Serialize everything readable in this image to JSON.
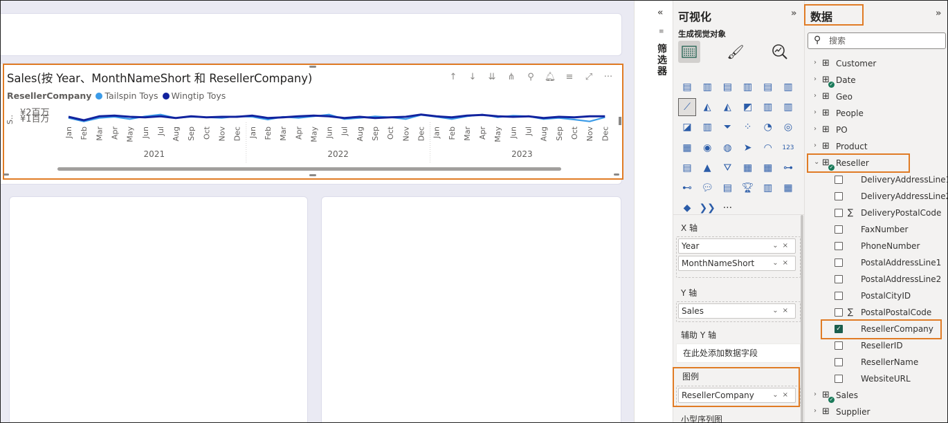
{
  "visual": {
    "title": "Sales(按 Year、MonthNameShort 和 ResellerCompany)",
    "legend_title": "ResellerCompany",
    "toolbar_icons": [
      "drill-up-icon",
      "drill-down-icon",
      "expand-all-icon",
      "hierarchy-icon",
      "pin-icon",
      "bell-icon",
      "filter-icon",
      "focus-mode-icon",
      "more-options-icon"
    ]
  },
  "chart_data": {
    "type": "line",
    "title": "Sales(按 Year、MonthNameShort 和 ResellerCompany)",
    "ylabel": "S..",
    "y_ticks": [
      "¥2百万",
      "¥1百万"
    ],
    "years": [
      "2021",
      "2022",
      "2023"
    ],
    "months": [
      "Jan",
      "Feb",
      "Mar",
      "Apr",
      "May",
      "Jun",
      "Jul",
      "Aug",
      "Sep",
      "Oct",
      "Nov",
      "Dec"
    ],
    "series": [
      {
        "name": "Tailspin Toys",
        "color": "#3b9be8",
        "values": [
          1.55,
          1.4,
          1.55,
          1.6,
          1.5,
          1.62,
          1.7,
          1.55,
          1.6,
          1.58,
          1.55,
          1.62,
          1.6,
          1.48,
          1.6,
          1.55,
          1.62,
          1.7,
          1.5,
          1.55,
          1.62,
          1.58,
          1.5,
          1.68,
          1.6,
          1.5,
          1.62,
          1.7,
          1.58,
          1.65,
          1.62,
          1.5,
          1.55,
          1.48,
          1.4,
          1.58
        ]
      },
      {
        "name": "Wingtip Toys",
        "color": "#12239e",
        "values": [
          1.6,
          1.45,
          1.62,
          1.65,
          1.6,
          1.58,
          1.62,
          1.55,
          1.62,
          1.58,
          1.6,
          1.6,
          1.65,
          1.55,
          1.58,
          1.62,
          1.65,
          1.62,
          1.55,
          1.6,
          1.55,
          1.58,
          1.6,
          1.7,
          1.62,
          1.58,
          1.65,
          1.68,
          1.62,
          1.6,
          1.62,
          1.55,
          1.6,
          1.58,
          1.62,
          1.62
        ]
      }
    ],
    "legend_position": "top-left"
  },
  "filters": {
    "label": "筛选器",
    "collapse_icon": "«"
  },
  "viz": {
    "title": "可视化",
    "subtitle": "生成视觉对象",
    "expand": "»",
    "wells": {
      "x_label": "X 轴",
      "x_fields": [
        "Year",
        "MonthNameShort"
      ],
      "y_label": "Y 轴",
      "y_fields": [
        "Sales"
      ],
      "y2_label": "辅助 Y 轴",
      "y2_placeholder": "在此处添加数据字段",
      "legend_label": "图例",
      "legend_fields": [
        "ResellerCompany"
      ],
      "small_multiples_label": "小型序列图"
    },
    "more": "···"
  },
  "data": {
    "title": "数据",
    "expand": "»",
    "search_placeholder": "搜索",
    "tables": [
      "Customer",
      "Date",
      "Geo",
      "People",
      "PO",
      "Product",
      "Reseller"
    ],
    "reseller_fields": [
      "DeliveryAddressLine1",
      "DeliveryAddressLine2",
      "DeliveryPostalCode",
      "FaxNumber",
      "PhoneNumber",
      "PostalAddressLine1",
      "PostalAddressLine2",
      "PostalCityID",
      "PostalPostalCode",
      "ResellerCompany",
      "ResellerID",
      "ResellerName",
      "WebsiteURL"
    ],
    "tables_after": [
      "Sales",
      "Supplier"
    ]
  }
}
